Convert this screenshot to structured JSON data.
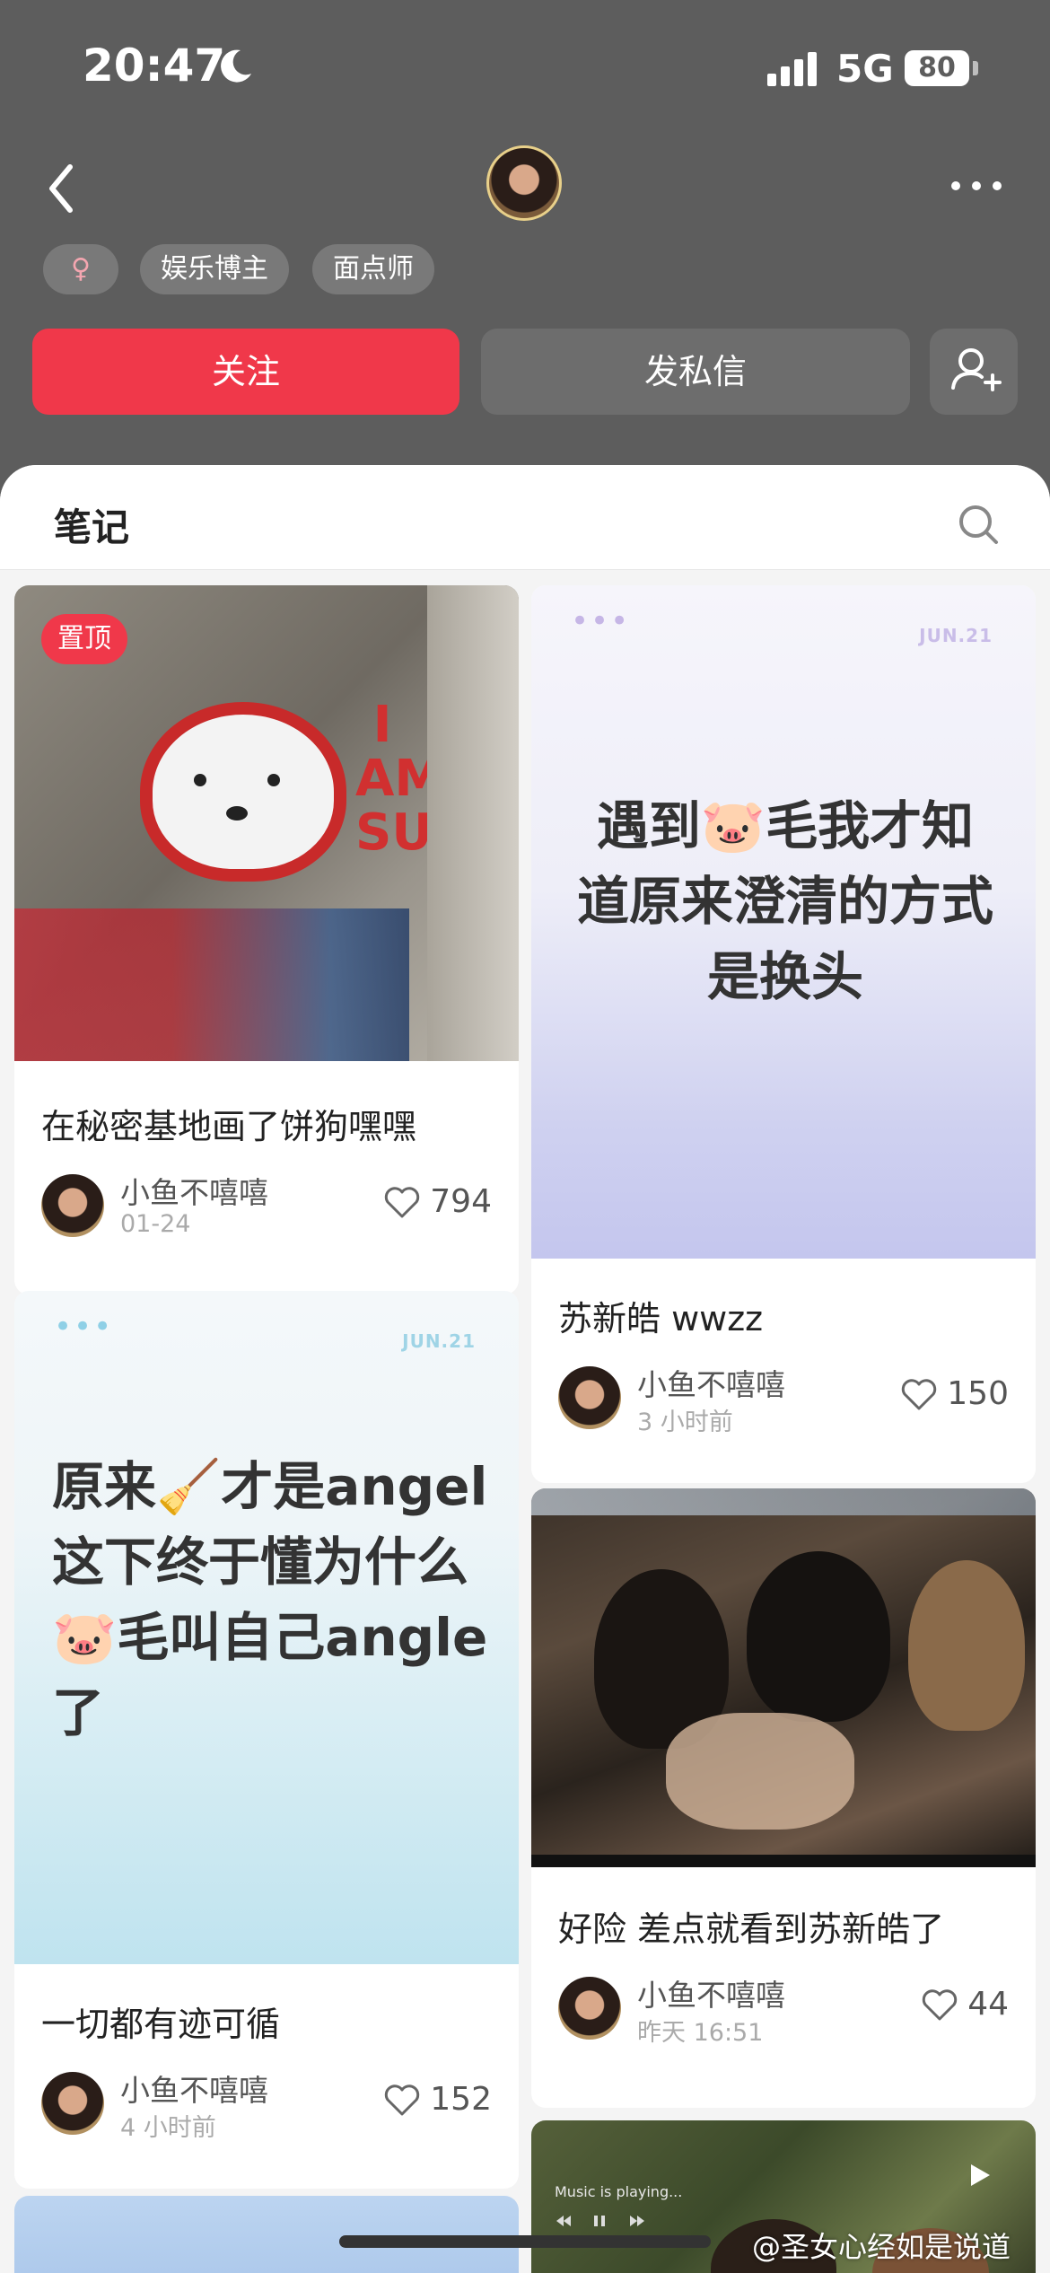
{
  "status_bar": {
    "time": "20:47",
    "network": "5G",
    "battery": "80"
  },
  "profile": {
    "tags": [
      "♀",
      "娱乐博主",
      "面点师"
    ],
    "follow_label": "关注",
    "message_label": "发私信"
  },
  "tabs": {
    "notes": "笔记"
  },
  "cards": [
    {
      "badge": "置顶",
      "title": "在秘密基地画了饼狗嘿嘿",
      "author": "小鱼不嘻嘻",
      "date": "01-24",
      "likes": "794",
      "mural_text": "I AM SU"
    },
    {
      "quote": "遇到🐷毛我才知道原来澄清的方式是换头",
      "jun": "JUN.21",
      "title": "苏新皓 wwzz",
      "author": "小鱼不嘻嘻",
      "date": "3 小时前",
      "likes": "150"
    },
    {
      "quote": "原来🧹才是angel这下终于懂为什么🐷毛叫自己angle了",
      "jun": "JUN.21",
      "title": "一切都有迹可循",
      "author": "小鱼不嘻嘻",
      "date": "4 小时前",
      "likes": "152"
    },
    {
      "title": "好险 差点就看到苏新皓了",
      "author": "小鱼不嘻嘻",
      "date": "昨天 16:51",
      "likes": "44"
    },
    {
      "music": "Music is playing..."
    }
  ],
  "watermark": "@圣女心经如是说道",
  "colors": {
    "accent": "#f0384a",
    "header": "#5d5d5d"
  }
}
